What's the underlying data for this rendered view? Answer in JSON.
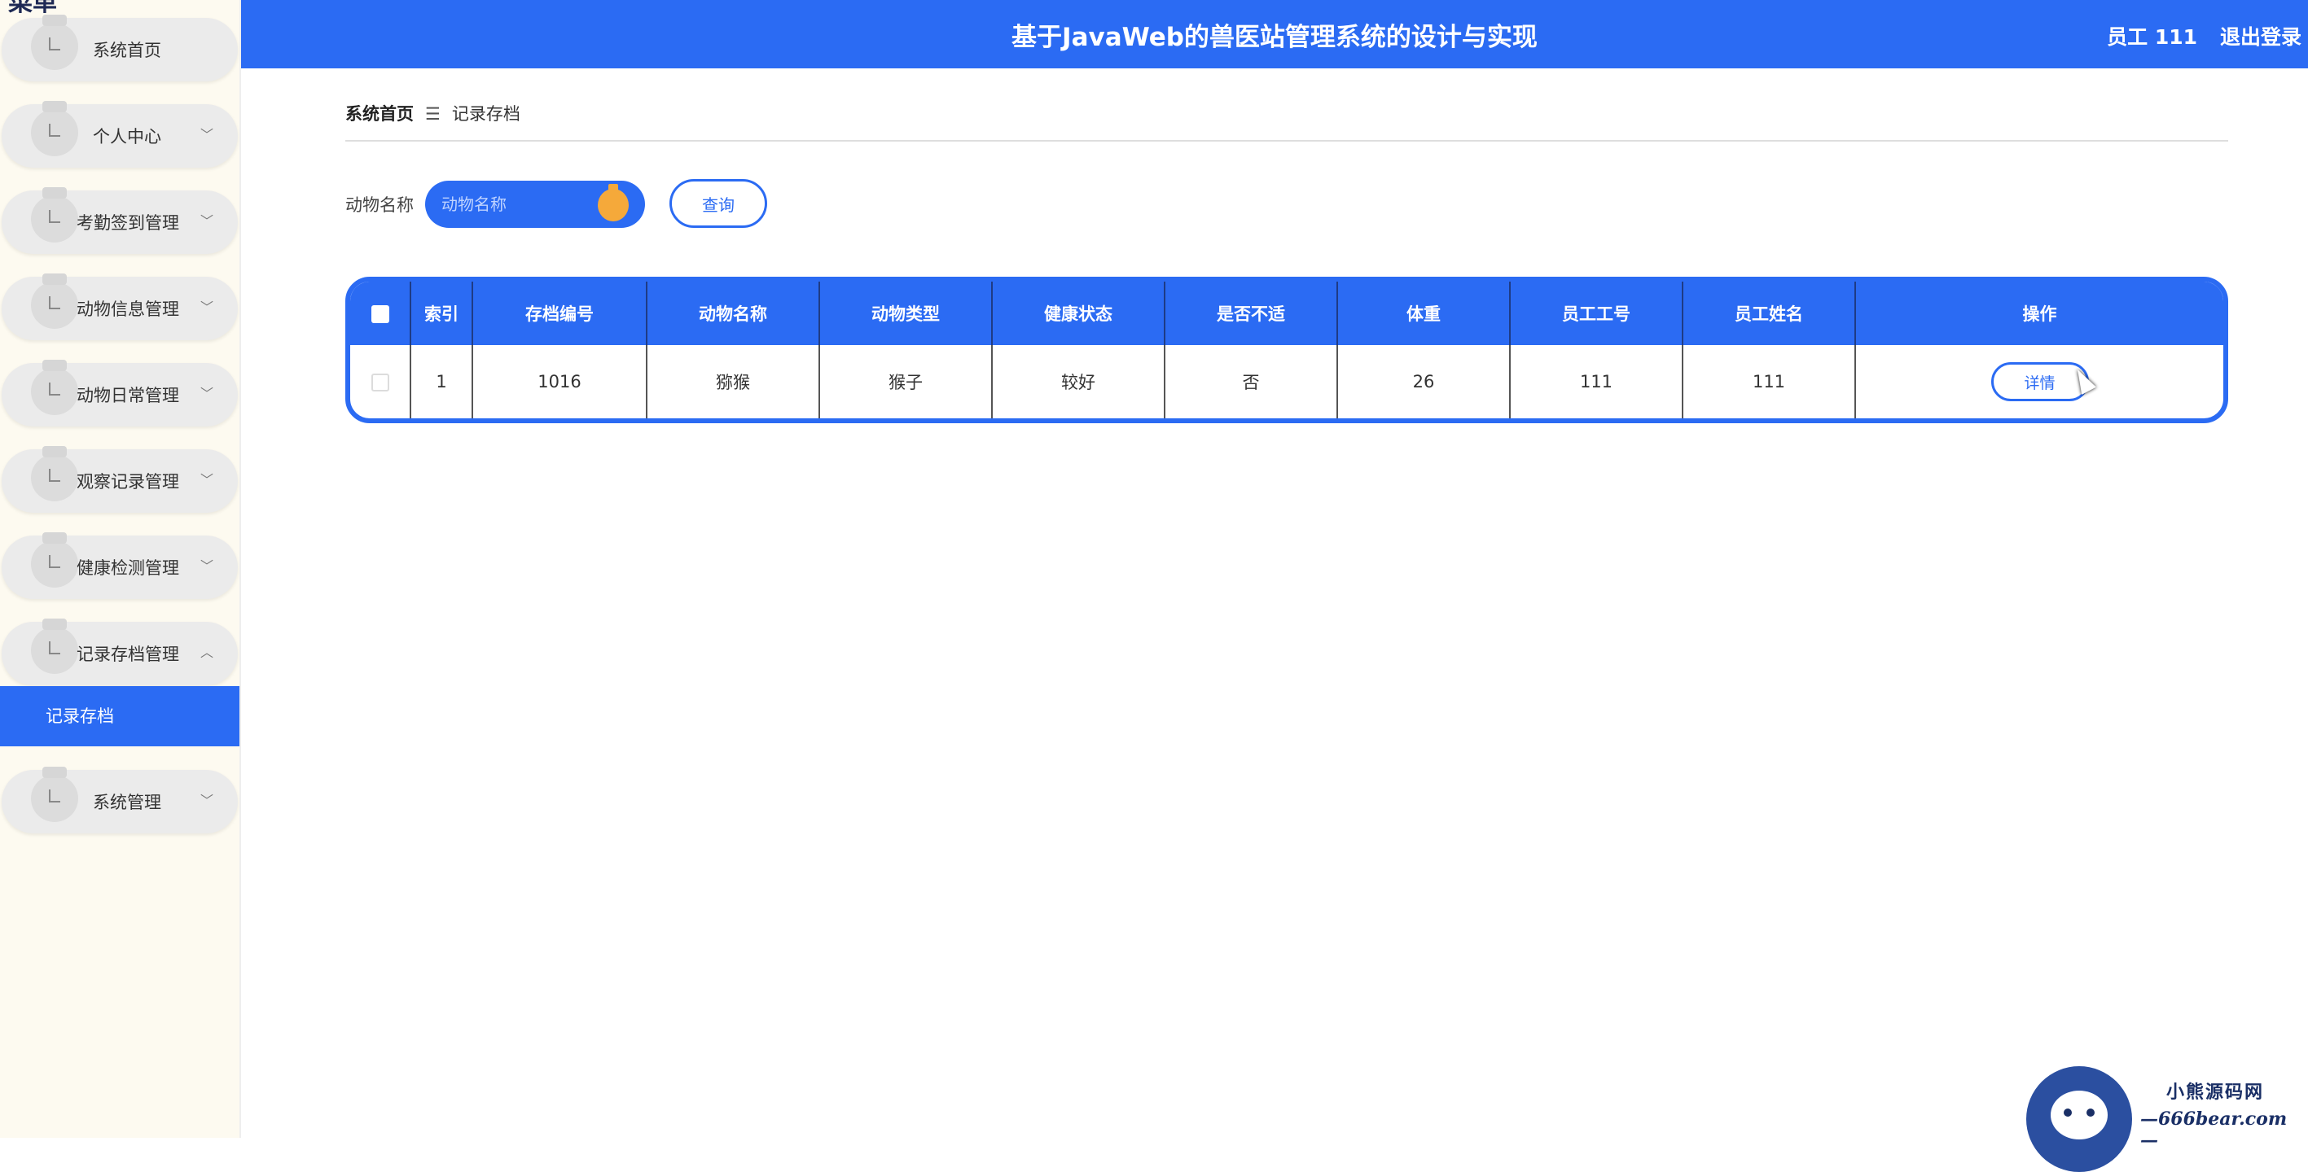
{
  "app": {
    "title": "基于JavaWeb的兽医站管理系统的设计与实现",
    "sidebar_cut_title": "菜单"
  },
  "header": {
    "user_label": "员工 111",
    "logout_label": "退出登录"
  },
  "sidebar": {
    "items": [
      {
        "label": "系统首页",
        "expandable": false
      },
      {
        "label": "个人中心",
        "expandable": true
      },
      {
        "label": "考勤签到管理",
        "expandable": true
      },
      {
        "label": "动物信息管理",
        "expandable": true
      },
      {
        "label": "动物日常管理",
        "expandable": true
      },
      {
        "label": "观察记录管理",
        "expandable": true
      },
      {
        "label": "健康检测管理",
        "expandable": true
      },
      {
        "label": "记录存档管理",
        "expandable": true,
        "expanded": true
      },
      {
        "label": "系统管理",
        "expandable": true
      }
    ],
    "active_subitem": "记录存档",
    "chevron_down": "﹀",
    "chevron_up": "︿"
  },
  "breadcrumb": {
    "home": "系统首页",
    "separator": "☰",
    "current": "记录存档"
  },
  "search": {
    "label": "动物名称",
    "placeholder": "动物名称",
    "value": "",
    "button_label": "查询"
  },
  "table": {
    "columns": [
      "",
      "索引",
      "存档编号",
      "动物名称",
      "动物类型",
      "健康状态",
      "是否不适",
      "体重",
      "员工工号",
      "员工姓名",
      "操作"
    ],
    "rows": [
      {
        "index": "1",
        "archive_no": "1016",
        "animal_name": "猕猴",
        "animal_type": "猴子",
        "health_status": "较好",
        "discomfort": "否",
        "weight": "26",
        "staff_no": "111",
        "staff_name": "111",
        "action_label": "详情"
      }
    ]
  },
  "watermark": {
    "line1": "小熊源码网",
    "line2": "—666bear.com—"
  },
  "colors": {
    "primary": "#2b6bf3",
    "sidebar_bg": "#fdfaf0",
    "menu_pill": "#ebebeb",
    "accent_orange": "#f5a93a"
  }
}
